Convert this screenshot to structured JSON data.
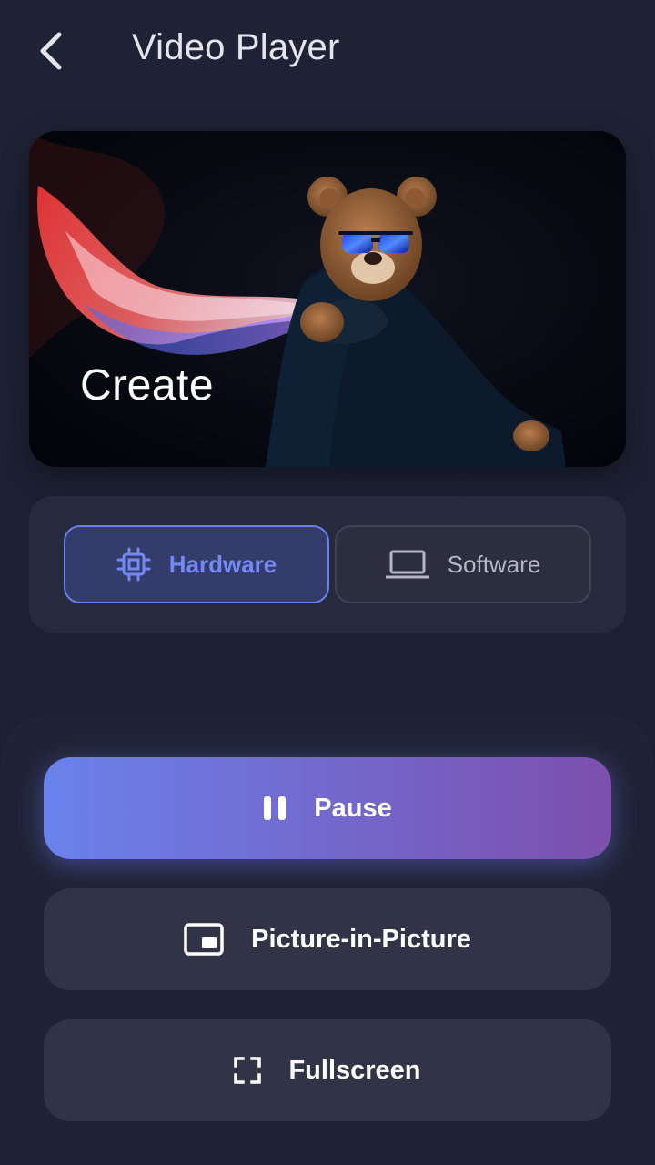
{
  "header": {
    "title": "Video Player",
    "back_icon": "chevron-left-icon"
  },
  "video": {
    "overlay_text": "Create",
    "scene_description_icon": "video-frame"
  },
  "decoder": {
    "options": [
      {
        "label": "Hardware",
        "icon": "cpu-chip-icon",
        "selected": true
      },
      {
        "label": "Software",
        "icon": "laptop-icon",
        "selected": false
      }
    ]
  },
  "controls": {
    "pause_label": "Pause",
    "pip_label": "Picture-in-Picture",
    "fullscreen_label": "Fullscreen"
  },
  "colors": {
    "accent": "#6d7ef0",
    "gradient_start": "#6a82ec",
    "gradient_end": "#7c4fae",
    "background": "#1e2235"
  }
}
